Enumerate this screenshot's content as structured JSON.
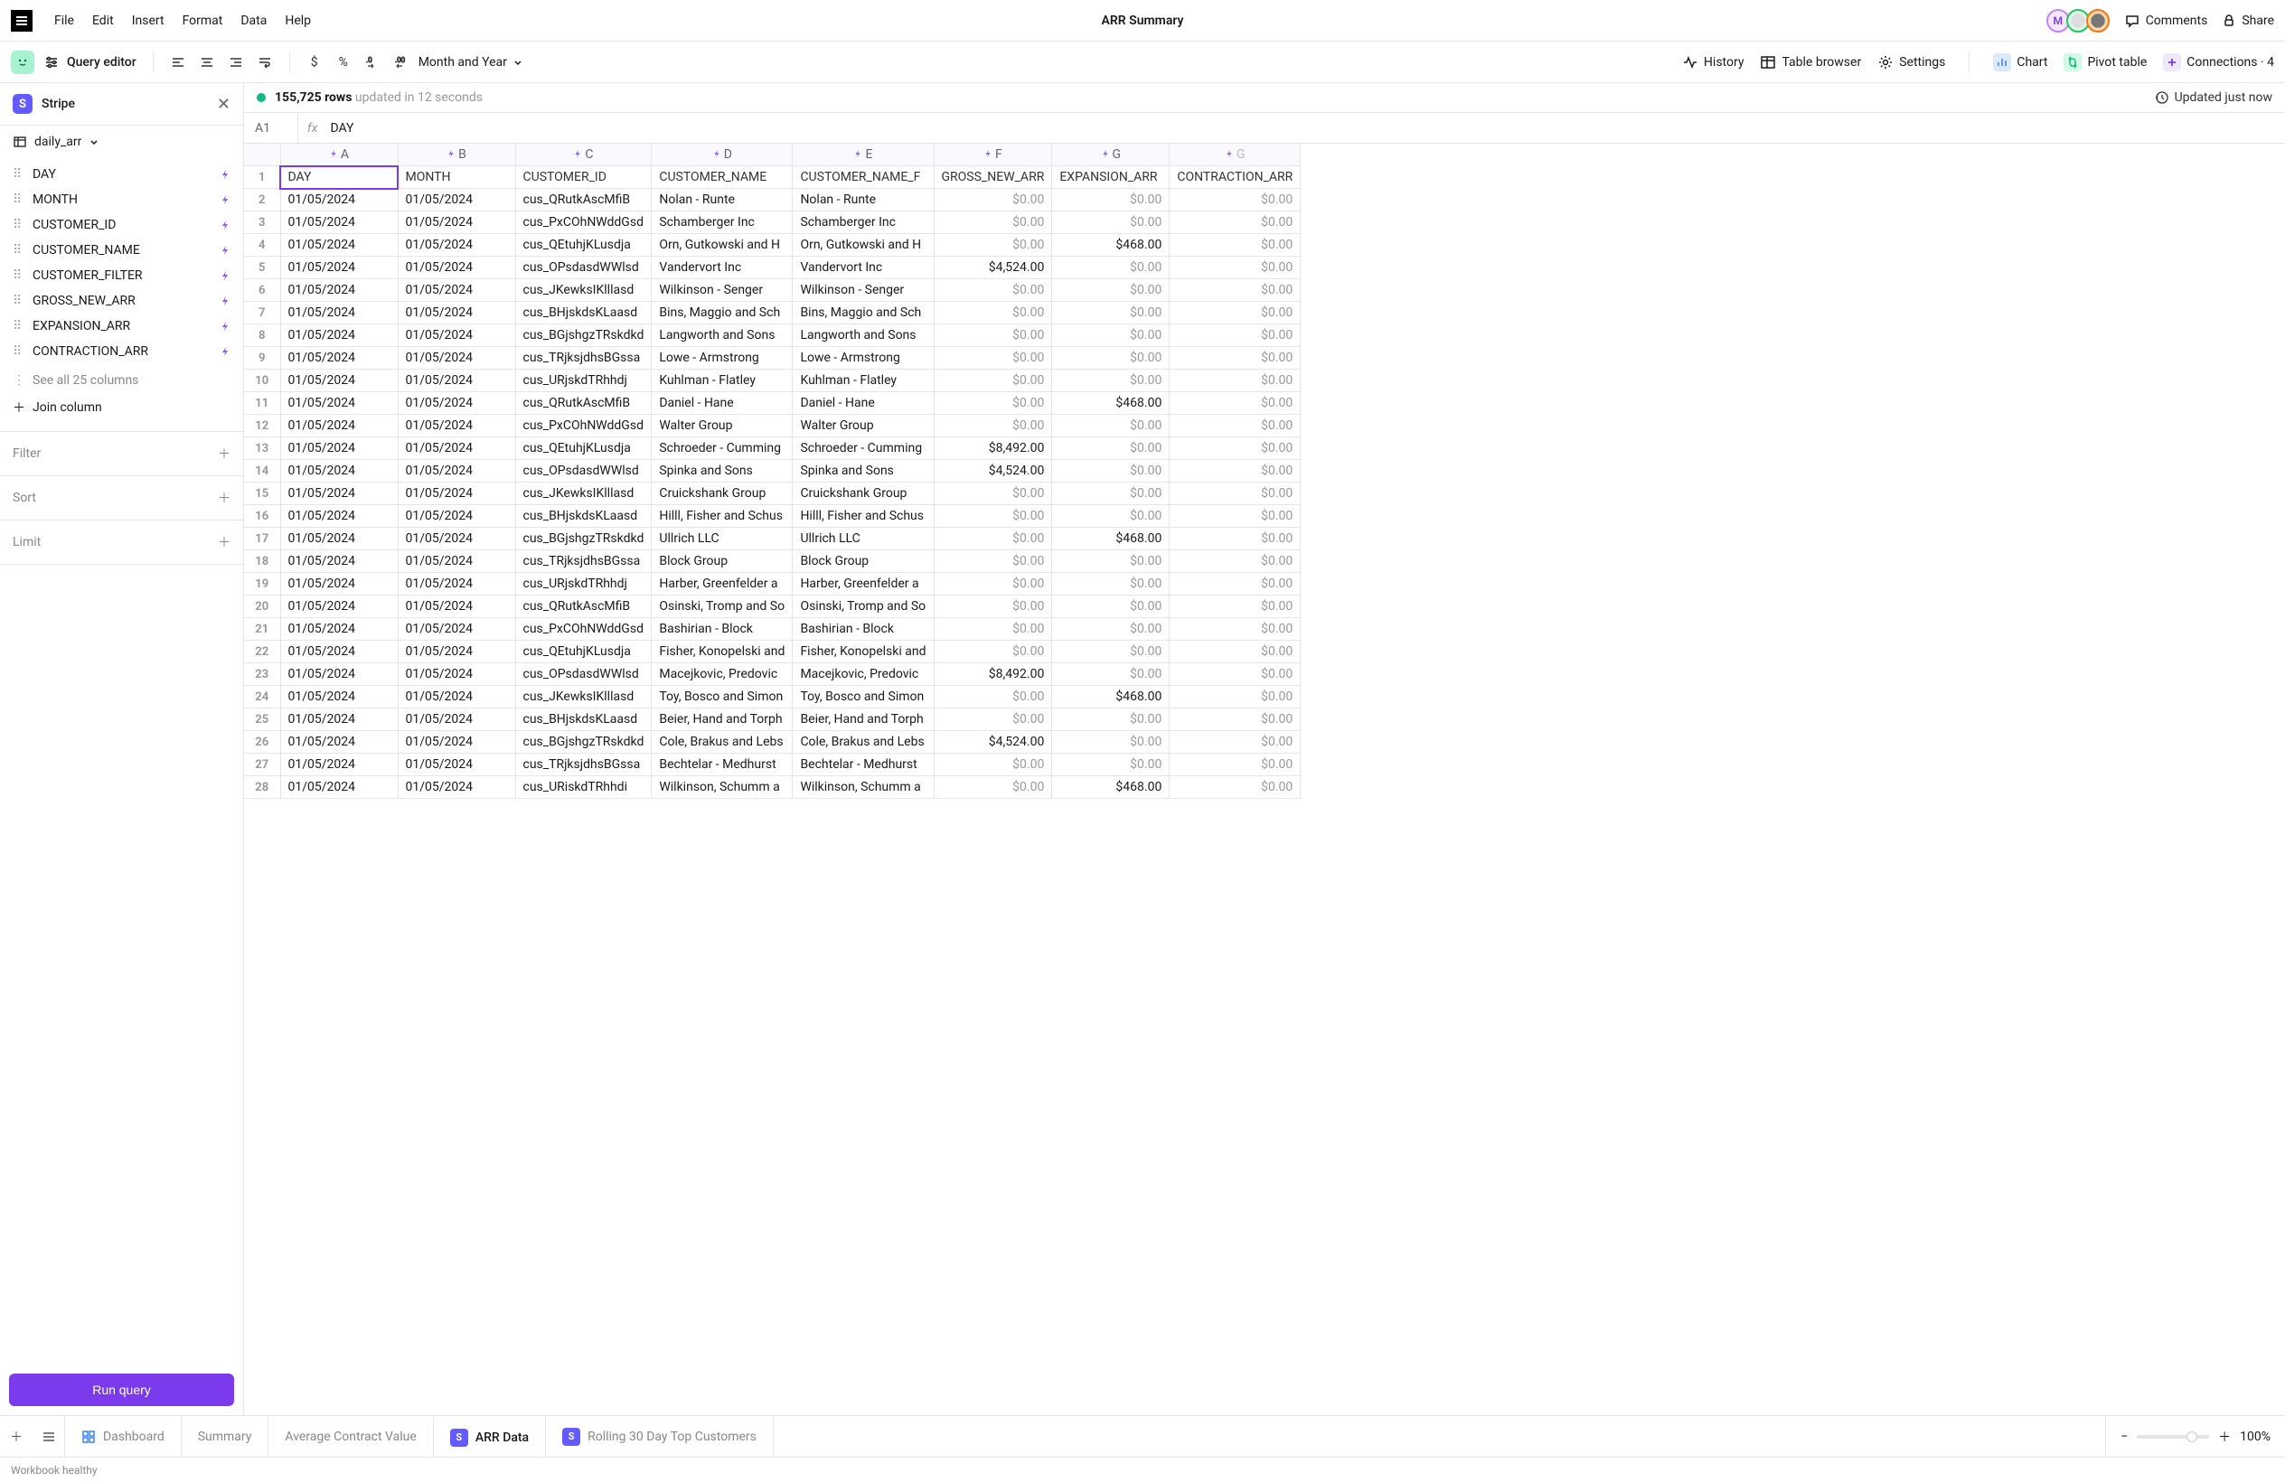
{
  "menubar": {
    "items": [
      "File",
      "Edit",
      "Insert",
      "Format",
      "Data",
      "Help"
    ],
    "title": "ARR Summary",
    "avatar_m": "M",
    "comments": "Comments",
    "share": "Share"
  },
  "toolbar": {
    "query_editor": "Query editor",
    "month_year": "Month and Year",
    "history": "History",
    "table_browser": "Table browser",
    "settings": "Settings",
    "chart": "Chart",
    "pivot_table": "Pivot table",
    "connections": "Connections · 4"
  },
  "sidebar": {
    "source": "Stripe",
    "table": "daily_arr",
    "columns": [
      "DAY",
      "MONTH",
      "CUSTOMER_ID",
      "CUSTOMER_NAME",
      "CUSTOMER_FILTER",
      "GROSS_NEW_ARR",
      "EXPANSION_ARR",
      "CONTRACTION_ARR"
    ],
    "see_all": "See all 25 columns",
    "join": "Join column",
    "filter": "Filter",
    "sort": "Sort",
    "limit": "Limit",
    "run_query": "Run query"
  },
  "status": {
    "rows": "155,725 rows",
    "updated_in": "updated in 12 seconds",
    "updated_just_now": "Updated just now",
    "cell_ref": "A1",
    "fx": "fx",
    "formula": "DAY"
  },
  "grid": {
    "col_letters": [
      "A",
      "B",
      "C",
      "D",
      "E",
      "F",
      "G",
      "G"
    ],
    "headers": [
      "DAY",
      "MONTH",
      "CUSTOMER_ID",
      "CUSTOMER_NAME",
      "CUSTOMER_NAME_F",
      "GROSS_NEW_ARR",
      "EXPANSION_ARR",
      "CONTRACTION_ARR"
    ],
    "rows": [
      [
        "01/05/2024",
        "01/05/2024",
        "cus_QRutkAscMfiB",
        "Nolan - Runte",
        "Nolan - Runte",
        "$0.00",
        "$0.00",
        "$0.00"
      ],
      [
        "01/05/2024",
        "01/05/2024",
        "cus_PxCOhNWddGsd",
        "Schamberger Inc",
        "Schamberger Inc",
        "$0.00",
        "$0.00",
        "$0.00"
      ],
      [
        "01/05/2024",
        "01/05/2024",
        "cus_QEtuhjKLusdja",
        "Orn, Gutkowski and H",
        "Orn, Gutkowski and H",
        "$0.00",
        "$468.00",
        "$0.00"
      ],
      [
        "01/05/2024",
        "01/05/2024",
        "cus_OPsdasdWWlsd",
        "Vandervort Inc",
        "Vandervort Inc",
        "$4,524.00",
        "$0.00",
        "$0.00"
      ],
      [
        "01/05/2024",
        "01/05/2024",
        "cus_JKewksIKlllasd",
        "Wilkinson - Senger",
        "Wilkinson - Senger",
        "$0.00",
        "$0.00",
        "$0.00"
      ],
      [
        "01/05/2024",
        "01/05/2024",
        "cus_BHjskdsKLaasd",
        "Bins, Maggio and Sch",
        "Bins, Maggio and Sch",
        "$0.00",
        "$0.00",
        "$0.00"
      ],
      [
        "01/05/2024",
        "01/05/2024",
        "cus_BGjshgzTRskdkd",
        "Langworth and Sons",
        "Langworth and Sons",
        "$0.00",
        "$0.00",
        "$0.00"
      ],
      [
        "01/05/2024",
        "01/05/2024",
        "cus_TRjksjdhsBGssa",
        "Lowe - Armstrong",
        "Lowe - Armstrong",
        "$0.00",
        "$0.00",
        "$0.00"
      ],
      [
        "01/05/2024",
        "01/05/2024",
        "cus_URjskdTRhhdj",
        "Kuhlman - Flatley",
        "Kuhlman - Flatley",
        "$0.00",
        "$0.00",
        "$0.00"
      ],
      [
        "01/05/2024",
        "01/05/2024",
        "cus_QRutkAscMfiB",
        "Daniel - Hane",
        "Daniel - Hane",
        "$0.00",
        "$468.00",
        "$0.00"
      ],
      [
        "01/05/2024",
        "01/05/2024",
        "cus_PxCOhNWddGsd",
        "Walter Group",
        "Walter Group",
        "$0.00",
        "$0.00",
        "$0.00"
      ],
      [
        "01/05/2024",
        "01/05/2024",
        "cus_QEtuhjKLusdja",
        "Schroeder - Cumming",
        "Schroeder - Cumming",
        "$8,492.00",
        "$0.00",
        "$0.00"
      ],
      [
        "01/05/2024",
        "01/05/2024",
        "cus_OPsdasdWWlsd",
        "Spinka and Sons",
        "Spinka and Sons",
        "$4,524.00",
        "$0.00",
        "$0.00"
      ],
      [
        "01/05/2024",
        "01/05/2024",
        "cus_JKewksIKlllasd",
        "Cruickshank Group",
        "Cruickshank Group",
        "$0.00",
        "$0.00",
        "$0.00"
      ],
      [
        "01/05/2024",
        "01/05/2024",
        "cus_BHjskdsKLaasd",
        "Hilll, Fisher and Schus",
        "Hilll, Fisher and Schus",
        "$0.00",
        "$0.00",
        "$0.00"
      ],
      [
        "01/05/2024",
        "01/05/2024",
        "cus_BGjshgzTRskdkd",
        "Ullrich LLC",
        "Ullrich LLC",
        "$0.00",
        "$468.00",
        "$0.00"
      ],
      [
        "01/05/2024",
        "01/05/2024",
        "cus_TRjksjdhsBGssa",
        "Block Group",
        "Block Group",
        "$0.00",
        "$0.00",
        "$0.00"
      ],
      [
        "01/05/2024",
        "01/05/2024",
        "cus_URjskdTRhhdj",
        "Harber, Greenfelder a",
        "Harber, Greenfelder a",
        "$0.00",
        "$0.00",
        "$0.00"
      ],
      [
        "01/05/2024",
        "01/05/2024",
        "cus_QRutkAscMfiB",
        "Osinski, Tromp and So",
        "Osinski, Tromp and So",
        "$0.00",
        "$0.00",
        "$0.00"
      ],
      [
        "01/05/2024",
        "01/05/2024",
        "cus_PxCOhNWddGsd",
        "Bashirian - Block",
        "Bashirian - Block",
        "$0.00",
        "$0.00",
        "$0.00"
      ],
      [
        "01/05/2024",
        "01/05/2024",
        "cus_QEtuhjKLusdja",
        "Fisher, Konopelski and",
        "Fisher, Konopelski and",
        "$0.00",
        "$0.00",
        "$0.00"
      ],
      [
        "01/05/2024",
        "01/05/2024",
        "cus_OPsdasdWWlsd",
        "Macejkovic, Predovic",
        "Macejkovic, Predovic",
        "$8,492.00",
        "$0.00",
        "$0.00"
      ],
      [
        "01/05/2024",
        "01/05/2024",
        "cus_JKewksIKlllasd",
        "Toy, Bosco and Simon",
        "Toy, Bosco and Simon",
        "$0.00",
        "$468.00",
        "$0.00"
      ],
      [
        "01/05/2024",
        "01/05/2024",
        "cus_BHjskdsKLaasd",
        "Beier, Hand and Torph",
        "Beier, Hand and Torph",
        "$0.00",
        "$0.00",
        "$0.00"
      ],
      [
        "01/05/2024",
        "01/05/2024",
        "cus_BGjshgzTRskdkd",
        "Cole, Brakus and Lebs",
        "Cole, Brakus and Lebs",
        "$4,524.00",
        "$0.00",
        "$0.00"
      ],
      [
        "01/05/2024",
        "01/05/2024",
        "cus_TRjksjdhsBGssa",
        "Bechtelar - Medhurst",
        "Bechtelar - Medhurst",
        "$0.00",
        "$0.00",
        "$0.00"
      ],
      [
        "01/05/2024",
        "01/05/2024",
        "cus_URiskdTRhhdi",
        "Wilkinson, Schumm a",
        "Wilkinson, Schumm a",
        "$0.00",
        "$468.00",
        "$0.00"
      ]
    ]
  },
  "tabs": {
    "dashboard": "Dashboard",
    "summary": "Summary",
    "acv": "Average Contract Value",
    "arr_data": "ARR Data",
    "rolling": "Rolling 30 Day Top Customers",
    "zoom": "100%"
  },
  "statusbar": {
    "health": "Workbook healthy"
  }
}
